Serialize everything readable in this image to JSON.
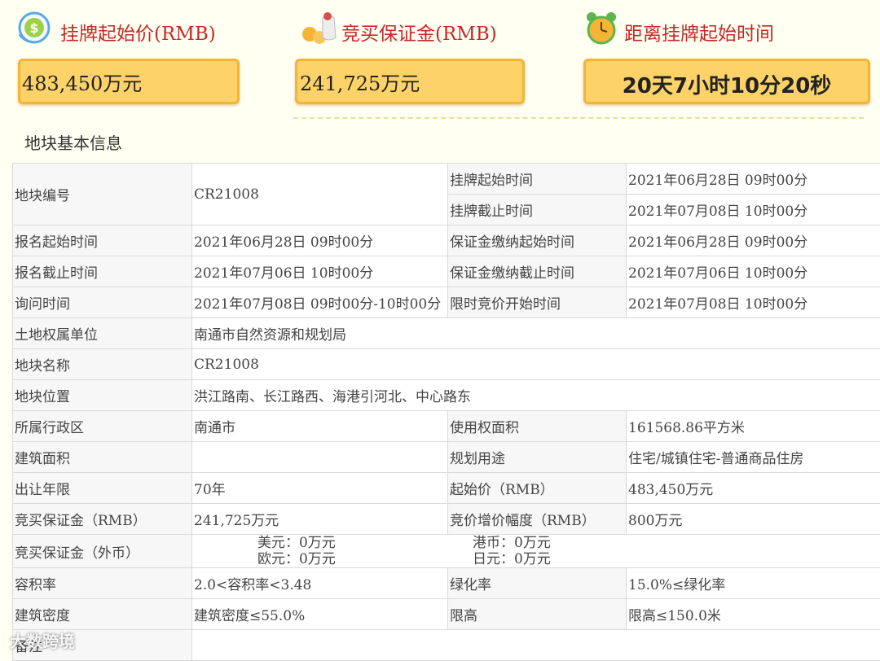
{
  "header": {
    "start_price": {
      "label": "挂牌起始价(RMB)",
      "value": "483,450万元",
      "icon": "dollar-coin-icon"
    },
    "deposit": {
      "label": "竞买保证金(RMB)",
      "value": "241,725万元",
      "icon": "money-bag-icon"
    },
    "countdown": {
      "label": "距离挂牌起始时间",
      "value": "20天7小时10分20秒",
      "icon": "alarm-clock-icon"
    }
  },
  "section_title": "地块基本信息",
  "table": {
    "r1": {
      "l1": "地块编号",
      "v1": "CR21008",
      "l2a": "挂牌起始时间",
      "v2a": "2021年06月28日 09时00分",
      "l2b": "挂牌截止时间",
      "v2b": "2021年07月08日 10时00分"
    },
    "r2": {
      "l1": "报名起始时间",
      "v1": "2021年06月28日 09时00分",
      "l2": "保证金缴纳起始时间",
      "v2": "2021年06月28日 09时00分"
    },
    "r3": {
      "l1": "报名截止时间",
      "v1": "2021年07月06日 10时00分",
      "l2": "保证金缴纳截止时间",
      "v2": "2021年07月06日 10时00分"
    },
    "r4": {
      "l1": "询问时间",
      "v1": "2021年07月08日 09时00分-10时00分",
      "l2": "限时竞价开始时间",
      "v2": "2021年07月08日 10时00分"
    },
    "r5": {
      "l": "土地权属单位",
      "v": "南通市自然资源和规划局"
    },
    "r6": {
      "l": "地块名称",
      "v": "CR21008"
    },
    "r7": {
      "l": "地块位置",
      "v": "洪江路南、长江路西、海港引河北、中心路东"
    },
    "r8": {
      "l1": "所属行政区",
      "v1": "南通市",
      "l2": "使用权面积",
      "v2": "161568.86平方米"
    },
    "r9": {
      "l1": "建筑面积",
      "v1": "",
      "l2": "规划用途",
      "v2": "住宅/城镇住宅-普通商品住房"
    },
    "r10": {
      "l1": "出让年限",
      "v1": "70年",
      "l2": "起始价（RMB）",
      "v2": "483,450万元"
    },
    "r11": {
      "l1": "竞买保证金（RMB）",
      "v1": "241,725万元",
      "l2": "竞价增价幅度（RMB）",
      "v2": "800万元"
    },
    "r12": {
      "l": "竞买保证金（外币）",
      "usd": "美元：0万元",
      "eur": "欧元：0万元",
      "hkd": "港币：0万元",
      "jpy": "日元：0万元"
    },
    "r13": {
      "l1": "容积率",
      "v1": "2.0<容积率<3.48",
      "l2": "绿化率",
      "v2": "15.0%≤绿化率"
    },
    "r14": {
      "l1": "建筑密度",
      "v1": "建筑密度≤55.0%",
      "l2": "限高",
      "v2": "限高≤150.0米"
    },
    "r15": {
      "l": "备注",
      "v": ""
    }
  },
  "watermark": "大数跨境"
}
